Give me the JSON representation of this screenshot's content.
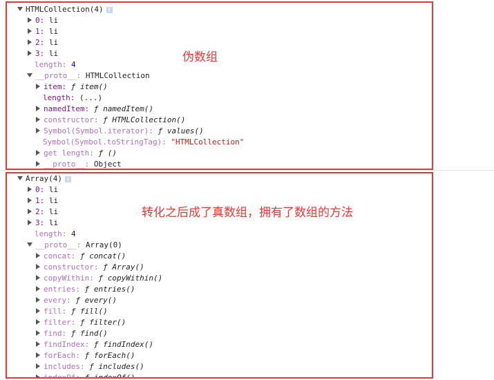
{
  "panel1": {
    "header": "HTMLCollection(4)",
    "info_glyph": "i",
    "annotation": "伪数组",
    "items": [
      {
        "key": "0",
        "sep": ": ",
        "value": "li"
      },
      {
        "key": "1",
        "sep": ": ",
        "value": "li"
      },
      {
        "key": "2",
        "sep": ": ",
        "value": "li"
      },
      {
        "key": "3",
        "sep": ": ",
        "value": "li"
      }
    ],
    "length": {
      "key": "length",
      "sep": ": ",
      "value": "4"
    },
    "proto": {
      "key": "__proto__",
      "sep": ": ",
      "value": "HTMLCollection"
    },
    "proto_items": [
      {
        "key": "item",
        "sep": ": ",
        "value": "ƒ item()",
        "expandable": true
      },
      {
        "key": "length",
        "sep": ": ",
        "value": "(...)",
        "expandable": false
      },
      {
        "key": "namedItem",
        "sep": ": ",
        "value": "ƒ namedItem()",
        "expandable": true
      },
      {
        "key": "constructor",
        "sep": ": ",
        "value": "ƒ HTMLCollection()",
        "expandable": true
      },
      {
        "key": "Symbol(Symbol.iterator)",
        "sep": ": ",
        "value": "ƒ values()",
        "expandable": true
      },
      {
        "key": "Symbol(Symbol.toStringTag)",
        "sep": ": ",
        "value": "\"HTMLCollection\"",
        "expandable": false
      },
      {
        "key": "get length",
        "sep": ": ",
        "value": "ƒ ()",
        "expandable": true
      },
      {
        "key": "__proto__",
        "sep": ": ",
        "value": "Object",
        "expandable": true
      }
    ]
  },
  "panel2": {
    "header": "Array(4)",
    "info_glyph": "i",
    "annotation": "转化之后成了真数组，拥有了数组的方法",
    "items": [
      {
        "key": "0",
        "sep": ": ",
        "value": "li"
      },
      {
        "key": "1",
        "sep": ": ",
        "value": "li"
      },
      {
        "key": "2",
        "sep": ": ",
        "value": "li"
      },
      {
        "key": "3",
        "sep": ": ",
        "value": "li"
      }
    ],
    "length": {
      "key": "length",
      "sep": ": ",
      "value": "4"
    },
    "proto": {
      "key": "__proto__",
      "sep": ": ",
      "value": "Array(0)"
    },
    "proto_items": [
      {
        "key": "concat",
        "sep": ": ",
        "value": "ƒ concat()"
      },
      {
        "key": "constructor",
        "sep": ": ",
        "value": "ƒ Array()"
      },
      {
        "key": "copyWithin",
        "sep": ": ",
        "value": "ƒ copyWithin()"
      },
      {
        "key": "entries",
        "sep": ": ",
        "value": "ƒ entries()"
      },
      {
        "key": "every",
        "sep": ": ",
        "value": "ƒ every()"
      },
      {
        "key": "fill",
        "sep": ": ",
        "value": "ƒ fill()"
      },
      {
        "key": "filter",
        "sep": ": ",
        "value": "ƒ filter()"
      },
      {
        "key": "find",
        "sep": ": ",
        "value": "ƒ find()"
      },
      {
        "key": "findIndex",
        "sep": ": ",
        "value": "ƒ findIndex()"
      },
      {
        "key": "forEach",
        "sep": ": ",
        "value": "ƒ forEach()"
      },
      {
        "key": "includes",
        "sep": ": ",
        "value": "ƒ includes()"
      },
      {
        "key": "indexOf",
        "sep": ": ",
        "value": "ƒ indexOf()"
      }
    ]
  }
}
